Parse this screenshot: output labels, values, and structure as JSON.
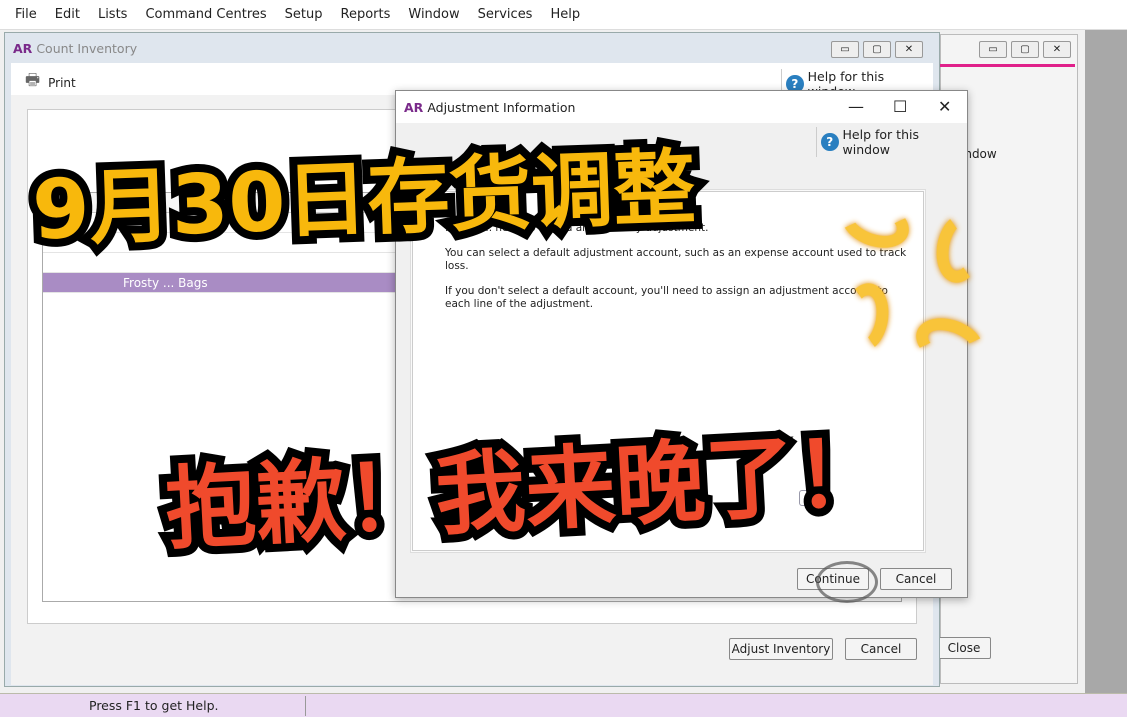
{
  "menu": [
    "File",
    "Edit",
    "Lists",
    "Command Centres",
    "Setup",
    "Reports",
    "Window",
    "Services",
    "Help"
  ],
  "count_inventory": {
    "logo": "AR",
    "title": "Count Inventory",
    "print": "Print",
    "help": "Help for this window",
    "selected_row": "Frosty ... Bags",
    "adjust_button": "Adjust Inventory",
    "cancel_button": "Cancel"
  },
  "back_window": {
    "help_fragment": "indow",
    "close_button": "Close"
  },
  "dialog": {
    "logo": "AR",
    "title": "Adjustment Information",
    "help": "Help for this window",
    "paragraphs": [
      "...date ... need to record an inventory adjustment.",
      "You can select a default adjustment account, such as an expense account used to track loss.",
      "If you don't select a default account, you'll need to assign an adjustment account to each line of the adjustment."
    ],
    "continue_button": "Continue",
    "cancel_button": "Cancel"
  },
  "status": {
    "text": "Press F1 to get Help."
  },
  "overlay": {
    "headline": "9月30日存货调整",
    "subline": "抱歉！我来晚了！"
  },
  "colors": {
    "accent": "#7a2a8a",
    "selection": "#a98cc4",
    "headline": "#f8b80c",
    "subline": "#f04a2c"
  }
}
